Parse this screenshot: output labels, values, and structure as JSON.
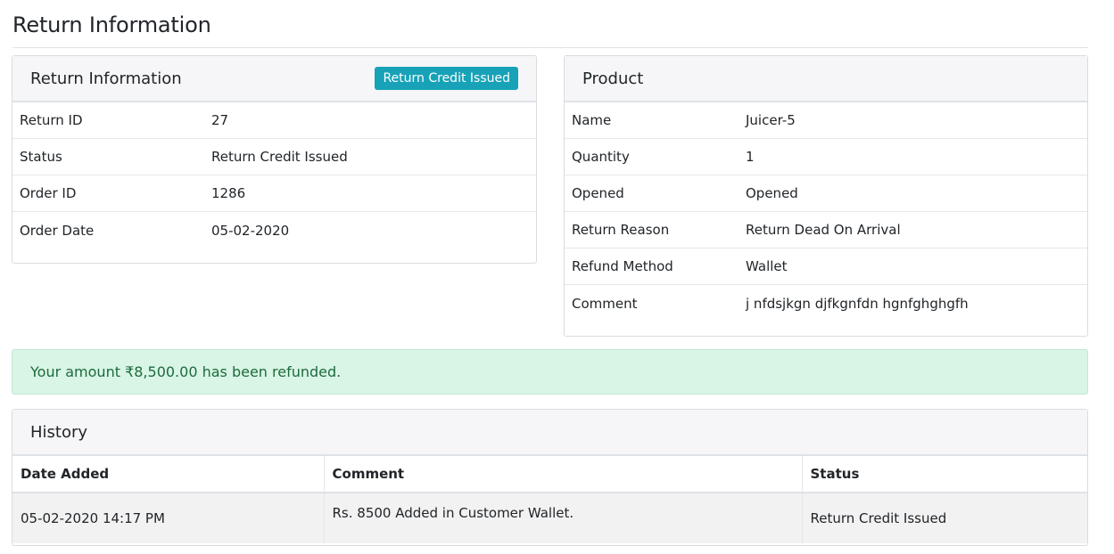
{
  "page": {
    "title": "Return Information"
  },
  "return_info": {
    "header": "Return Information",
    "status_button": "Return Credit Issued",
    "rows": [
      {
        "key": "Return ID",
        "value": "27"
      },
      {
        "key": "Status",
        "value": "Return Credit Issued"
      },
      {
        "key": "Order ID",
        "value": "1286"
      },
      {
        "key": "Order Date",
        "value": "05-02-2020"
      }
    ]
  },
  "product": {
    "header": "Product",
    "rows": [
      {
        "key": "Name",
        "value": "Juicer-5"
      },
      {
        "key": "Quantity",
        "value": "1"
      },
      {
        "key": "Opened",
        "value": "Opened"
      },
      {
        "key": "Return Reason",
        "value": "Return Dead On Arrival"
      },
      {
        "key": "Refund Method",
        "value": "Wallet"
      },
      {
        "key": "Comment",
        "value": "j nfdsjkgn djfkgnfdn hgnfghghgfh"
      }
    ]
  },
  "alert": {
    "text": "Your amount ₹8,500.00 has been refunded."
  },
  "history": {
    "header": "History",
    "columns": [
      "Date Added",
      "Comment",
      "Status"
    ],
    "rows": [
      {
        "date": "05-02-2020 14:17 PM",
        "comment": "Rs. 8500 Added in Customer Wallet.",
        "status": "Return Credit Issued"
      }
    ]
  },
  "colors": {
    "accent": "#17a2b8",
    "success_bg": "#d9f5e6",
    "success_text": "#1c6b3c"
  }
}
